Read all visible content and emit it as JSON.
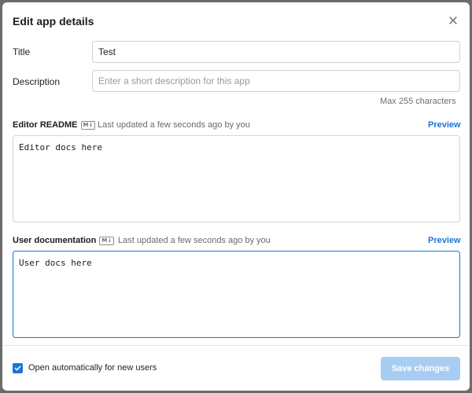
{
  "dialog": {
    "title": "Edit app details",
    "close_icon": "close-icon"
  },
  "form": {
    "title_label": "Title",
    "title_value": "Test",
    "description_label": "Description",
    "description_value": "",
    "description_placeholder": "Enter a short description for this app",
    "description_hint": "Max 255 characters"
  },
  "editor_readme": {
    "label": "Editor README",
    "badge": "M↓",
    "updated": "Last updated a few seconds ago by you",
    "preview": "Preview",
    "content": "Editor docs here"
  },
  "user_docs": {
    "label": "User documentation",
    "badge": "M↓",
    "updated": "Last updated a few seconds ago by you",
    "preview": "Preview",
    "content": "User docs here"
  },
  "footer": {
    "checkbox_checked": true,
    "checkbox_label": "Open automatically for new users",
    "save_label": "Save changes"
  },
  "colors": {
    "accent": "#1b74d6",
    "save_disabled": "#a8cdf3"
  }
}
